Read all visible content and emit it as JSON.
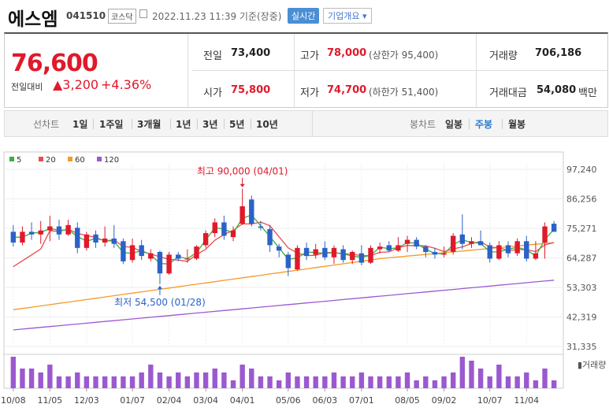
{
  "stock": {
    "name": "에스엠",
    "code": "041510",
    "market": "코스닥",
    "datetime": "2022.11.23 11:39 기준(장중)",
    "realtime_label": "실시간",
    "company_label": "기업개요 ▾"
  },
  "quote": {
    "price": "76,600",
    "compare_label": "전일대비",
    "change": "▲3,200",
    "change_pct": "+4.36%",
    "prev_close_label": "전일",
    "prev_close": "73,400",
    "open_label": "시가",
    "open": "75,800",
    "high_label": "고가",
    "high": "78,000",
    "upper_limit": "(상한가 95,400)",
    "low_label": "저가",
    "low": "74,700",
    "lower_limit": "(하한가 51,400)",
    "volume_label": "거래량",
    "volume": "706,186",
    "amount_label": "거래대금",
    "amount": "54,080",
    "amount_unit": "백만"
  },
  "tabs": {
    "line_label": "선차트",
    "line": [
      "1일",
      "1주일",
      "3개월",
      "1년",
      "3년",
      "5년",
      "10년"
    ],
    "candle_label": "봉차트",
    "candle": [
      "일봉",
      "주봉",
      "월봉"
    ],
    "active_candle": "주봉"
  },
  "colors": {
    "up": "#e0192b",
    "down": "#2a62c9",
    "ma5": "#3cae3c",
    "ma20": "#e94b4b",
    "ma60": "#f39b2b",
    "ma120": "#9b59d0",
    "volume": "#9b59d0"
  },
  "chart_data": {
    "type": "candlestick",
    "ylim": [
      31335,
      97240
    ],
    "yticks": [
      "97,240",
      "86,256",
      "75,271",
      "64,287",
      "53,303",
      "42,319",
      "31,335"
    ],
    "xticks": [
      "10/08",
      "11/05",
      "12/03",
      "01/07",
      "02/04",
      "03/04",
      "04/01",
      "05/06",
      "06/03",
      "07/01",
      "08/05",
      "09/02",
      "10/07",
      "11/04"
    ],
    "xtick_index": [
      0,
      4,
      8,
      13,
      17,
      21,
      25,
      30,
      34,
      38,
      43,
      47,
      52,
      56
    ],
    "legend": [
      "5",
      "20",
      "60",
      "120"
    ],
    "volume_label": "▮거래량",
    "max_label": "최고 90,000 (04/01)",
    "min_label": "최저 54,500 (01/28)",
    "max_index": 25,
    "min_index": 16,
    "candles": [
      [
        74000,
        76500,
        68500,
        70000
      ],
      [
        70000,
        76000,
        69000,
        74000
      ],
      [
        74000,
        77500,
        71000,
        73000
      ],
      [
        73000,
        78000,
        69500,
        74500
      ],
      [
        74500,
        80000,
        70500,
        76000
      ],
      [
        76000,
        78500,
        71000,
        73000
      ],
      [
        73000,
        78500,
        72500,
        76500
      ],
      [
        75500,
        77500,
        66000,
        68000
      ],
      [
        68000,
        74000,
        67000,
        73000
      ],
      [
        73000,
        74500,
        68000,
        70000
      ],
      [
        70000,
        76000,
        68500,
        71500
      ],
      [
        71500,
        76500,
        68000,
        69500
      ],
      [
        70500,
        71500,
        62000,
        63000
      ],
      [
        63500,
        71500,
        62500,
        69000
      ],
      [
        69000,
        71000,
        63500,
        65000
      ],
      [
        64000,
        67500,
        63000,
        66000
      ],
      [
        66500,
        67000,
        54500,
        58500
      ],
      [
        58500,
        66500,
        58000,
        65500
      ],
      [
        65500,
        66500,
        63000,
        64000
      ],
      [
        64000,
        67500,
        62500,
        64000
      ],
      [
        64000,
        69000,
        63500,
        68500
      ],
      [
        69000,
        74500,
        68000,
        73500
      ],
      [
        73500,
        79000,
        72000,
        77500
      ],
      [
        77500,
        80000,
        71000,
        72500
      ],
      [
        72000,
        76000,
        70500,
        74500
      ],
      [
        77000,
        90000,
        76500,
        83500
      ],
      [
        86000,
        87500,
        76000,
        77000
      ],
      [
        76000,
        78000,
        74500,
        75500
      ],
      [
        75000,
        76500,
        66500,
        69000
      ],
      [
        68500,
        69500,
        64500,
        67000
      ],
      [
        65500,
        66500,
        57500,
        60500
      ],
      [
        60000,
        69000,
        59500,
        68000
      ],
      [
        68000,
        70000,
        63500,
        65000
      ],
      [
        65500,
        69500,
        64000,
        67500
      ],
      [
        68000,
        70500,
        63500,
        64500
      ],
      [
        64500,
        69000,
        62000,
        68000
      ],
      [
        67500,
        69000,
        62500,
        63500
      ],
      [
        63500,
        67000,
        62000,
        66500
      ],
      [
        66000,
        69000,
        61500,
        62500
      ],
      [
        62500,
        69000,
        62000,
        68000
      ],
      [
        67500,
        70000,
        66000,
        68500
      ],
      [
        69000,
        70500,
        66500,
        67000
      ],
      [
        67000,
        72000,
        66500,
        69000
      ],
      [
        69500,
        72500,
        66500,
        71000
      ],
      [
        71000,
        72000,
        67500,
        68500
      ],
      [
        68500,
        69000,
        64500,
        66500
      ],
      [
        66500,
        68000,
        64000,
        65500
      ],
      [
        65500,
        68500,
        64500,
        66000
      ],
      [
        66500,
        73500,
        65500,
        72500
      ],
      [
        73000,
        80500,
        67500,
        69500
      ],
      [
        69500,
        72000,
        68000,
        70500
      ],
      [
        70500,
        74500,
        69000,
        69000
      ],
      [
        69000,
        70000,
        62500,
        64000
      ],
      [
        64000,
        70500,
        63500,
        69000
      ],
      [
        69000,
        70500,
        64500,
        66000
      ],
      [
        66000,
        71500,
        65000,
        70500
      ],
      [
        70500,
        72500,
        63000,
        64000
      ],
      [
        64000,
        70500,
        63500,
        66000
      ],
      [
        70000,
        77500,
        64000,
        76000
      ],
      [
        77000,
        78000,
        74000,
        74000
      ]
    ],
    "volume": [
      8,
      5,
      5,
      4,
      6,
      3,
      3,
      4,
      3,
      3,
      3,
      3,
      3,
      3,
      4,
      6,
      4,
      3,
      4,
      3,
      4,
      4,
      5,
      4,
      2,
      6,
      5,
      3,
      3,
      2,
      4,
      3,
      3,
      3,
      3,
      4,
      3,
      3,
      4,
      3,
      3,
      3,
      3,
      4,
      2,
      3,
      2,
      3,
      4,
      8,
      7,
      5,
      3,
      6,
      3,
      3,
      4,
      2,
      5,
      2
    ]
  }
}
